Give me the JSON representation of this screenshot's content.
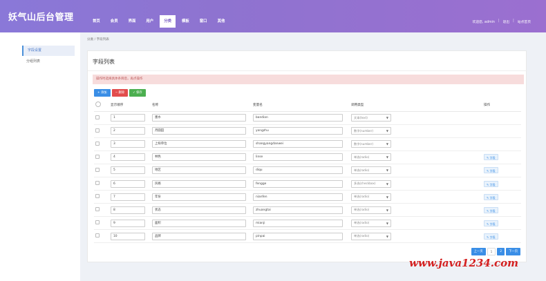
{
  "header": {
    "brand": "妖气山后台管理",
    "nav": [
      {
        "label": "首页",
        "active": false
      },
      {
        "label": "会员",
        "active": false
      },
      {
        "label": "界面",
        "active": false
      },
      {
        "label": "用户",
        "active": false
      },
      {
        "label": "分类",
        "active": true
      },
      {
        "label": "模板",
        "active": false
      },
      {
        "label": "窗口",
        "active": false
      },
      {
        "label": "其他",
        "active": false
      }
    ],
    "welcome": "欢迎您, admin",
    "logout": "退出",
    "site_home": "站点首页"
  },
  "sidebar": {
    "items": [
      {
        "label": "字段设置",
        "active": true
      },
      {
        "label": "分组列表",
        "active": false
      }
    ]
  },
  "breadcrumb": "分类 / 字段列表",
  "card": {
    "title": "字段列表",
    "alert": "操作时选择具体条目后，再点操作"
  },
  "toolbar": {
    "add_label": "+ 添加",
    "delete_label": "− 删除",
    "save_label": "✓ 保存"
  },
  "table": {
    "headers": [
      "",
      "显示顺序",
      "名称",
      "变量名",
      "调用类型",
      "操作"
    ],
    "rows": [
      {
        "order": "1",
        "name": "墨水",
        "var": "bandian",
        "type": "文本(text)",
        "op": ""
      },
      {
        "order": "2",
        "name": "月圆田",
        "var": "yongzhu",
        "type": "数字(number)",
        "op": ""
      },
      {
        "order": "3",
        "name": "上样单位",
        "var": "shangyangdanwei",
        "type": "数字(number)",
        "op": ""
      },
      {
        "order": "4",
        "name": "林色",
        "var": "linse",
        "type": "单选(radio)",
        "op": "✎ 字段"
      },
      {
        "order": "5",
        "name": "地区",
        "var": "diqu",
        "type": "单选(radio)",
        "op": "✎ 字段"
      },
      {
        "order": "6",
        "name": "风格",
        "var": "fengge",
        "type": "多选(checkbox)",
        "op": "✎ 字段"
      },
      {
        "order": "7",
        "name": "年份",
        "var": "nianfen",
        "type": "单选(radio)",
        "op": "✎ 字段"
      },
      {
        "order": "8",
        "name": "状态",
        "var": "zhuangtai",
        "type": "单选(radio)",
        "op": "✎ 字段"
      },
      {
        "order": "9",
        "name": "面积",
        "var": "mianji",
        "type": "单选(radio)",
        "op": "✎ 字段"
      },
      {
        "order": "10",
        "name": "品牌",
        "var": "pinpai",
        "type": "单选(radio)",
        "op": "✎ 字段"
      }
    ]
  },
  "pager": {
    "prev": "上一页",
    "pages": [
      "1",
      "2"
    ],
    "current": "2",
    "next": "下一页"
  },
  "watermark": "www.java1234.com"
}
